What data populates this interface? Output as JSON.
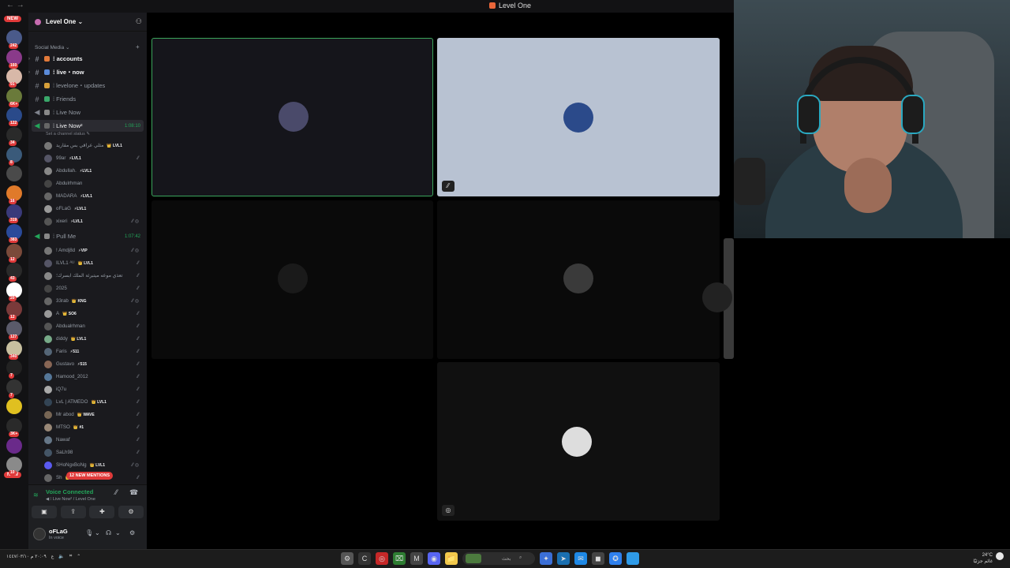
{
  "titlebar": {
    "title": "Level One",
    "back": "←  →"
  },
  "rail": {
    "new_top": "NEW",
    "new_bottom": "NEW",
    "servers": [
      {
        "badge": "242",
        "color": "#4a5a8a"
      },
      {
        "badge": "160",
        "color": "#8a3a8a"
      },
      {
        "badge": "91",
        "color": "#d8b8a8"
      },
      {
        "badge": "6K+",
        "color": "#6a7a3a"
      },
      {
        "badge": "122",
        "color": "#2a4a8a"
      },
      {
        "badge": "34",
        "color": "#2a2a2a"
      },
      {
        "badge": "8",
        "color": "#3a5a7a"
      },
      {
        "badge": "",
        "color": "#4a4a4a"
      },
      {
        "badge": "16",
        "color": "#e07a2a"
      },
      {
        "badge": "319",
        "color": "#3a3a7a"
      },
      {
        "badge": "383",
        "color": "#2a4a9a"
      },
      {
        "badge": "12",
        "color": "#7a4a3a"
      },
      {
        "badge": "43",
        "color": "#2a2a2a"
      },
      {
        "badge": "20",
        "color": "#ffffff"
      },
      {
        "badge": "12",
        "color": "#7a3a3a"
      },
      {
        "badge": "127",
        "color": "#5a5a6a"
      },
      {
        "badge": "340",
        "color": "#c8c0a0"
      },
      {
        "badge": "7",
        "color": "#222222"
      },
      {
        "badge": "7",
        "color": "#333333"
      },
      {
        "badge": "",
        "color": "#e0c020"
      },
      {
        "badge": "3K+",
        "color": "#2a2a2a"
      },
      {
        "badge": "",
        "color": "#6a2a8a"
      },
      {
        "badge": "10",
        "color": "#8a8a8a"
      }
    ]
  },
  "guild": {
    "name": "Level One ⌄",
    "invite_icon": "add-friend-icon"
  },
  "category": {
    "label": "Social Media ⌄",
    "plus": "+"
  },
  "channels": [
    {
      "hash": "#",
      "label": "⁞ accounts",
      "emoji": "#e27a3a",
      "bold": true,
      "arrow": "›"
    },
    {
      "hash": "#",
      "label": "⁞ live・now",
      "emoji": "#5a8ad8",
      "bold": true,
      "arrow": "›"
    },
    {
      "hash": "#",
      "label": "⁞ levelone・updates",
      "emoji": "#d8a03a",
      "bold": false,
      "arrow": ""
    },
    {
      "hash": "#",
      "label": "⁞ Friends",
      "emoji": "#3aa86a",
      "bold": false,
      "arrow": ""
    },
    {
      "hash": "◀",
      "label": "⁞ Live Now",
      "emoji": "#888888",
      "bold": false,
      "arrow": ""
    }
  ],
  "voice_channel_1": {
    "label": "⁞ Live Now²",
    "timer": "1:08:10",
    "status": "Set a channel status ✎"
  },
  "voice_users_1": [
    {
      "name": "مثلي عراقي بس مقاريد",
      "tag": "👑 LVL1",
      "icons": ""
    },
    {
      "name": "99ar",
      "tag": "⚡LVL1",
      "icons": "⁄⁄"
    },
    {
      "name": "Abdullah.",
      "tag": "⚡LVL1",
      "icons": ""
    },
    {
      "name": "Abdulrhman",
      "tag": "",
      "icons": ""
    },
    {
      "name": "MADARA",
      "tag": "⚡LVL1",
      "icons": ""
    },
    {
      "name": "oFLaG",
      "tag": "⚡LVL1",
      "icons": ""
    },
    {
      "name": "xixeri",
      "tag": "⚡LVL1",
      "icons": "⁄⁄ ◎"
    }
  ],
  "voice_channel_2": {
    "label": "⁞ Pull Me",
    "timer": "1:07:42"
  },
  "voice_users_2": [
    {
      "name": "! Amdj8d",
      "tag": "⚡VIP",
      "icons": "⁄⁄ ◎"
    },
    {
      "name": "ILVL1 ᴬᴸᴵ",
      "tag": "👑 LVL1",
      "icons": "⁄⁄"
    },
    {
      "name": "تعذي موعه ميتبرئة الملك ابسرك؛",
      "tag": "",
      "icons": "⁄⁄"
    },
    {
      "name": "2025",
      "tag": "",
      "icons": "⁄⁄"
    },
    {
      "name": "33rab",
      "tag": "👑 KNG",
      "icons": "⁄⁄ ◎"
    },
    {
      "name": "A",
      "tag": "👑 SO6",
      "icons": "⁄⁄"
    },
    {
      "name": "Abdualrhman",
      "tag": "",
      "icons": "⁄⁄"
    },
    {
      "name": "diddy",
      "tag": "👑 LVL1",
      "icons": "⁄⁄"
    },
    {
      "name": "Faris",
      "tag": "⚡511",
      "icons": "⁄⁄"
    },
    {
      "name": "Gustavo",
      "tag": "⚡515",
      "icons": "⁄⁄"
    },
    {
      "name": "Hamood_2012",
      "tag": "",
      "icons": "⁄⁄"
    },
    {
      "name": "iQ7u",
      "tag": "",
      "icons": "⁄⁄"
    },
    {
      "name": "LvL | ATMEDO",
      "tag": "👑 LVL1",
      "icons": "⁄⁄"
    },
    {
      "name": "Mr abod",
      "tag": "👑 WAVE",
      "icons": "⁄⁄"
    },
    {
      "name": "MTSO",
      "tag": "👑 #1",
      "icons": "⁄⁄"
    },
    {
      "name": "Nawaf",
      "tag": "",
      "icons": "⁄⁄"
    },
    {
      "name": "SaLh98",
      "tag": "",
      "icons": "⁄⁄"
    },
    {
      "name": "SHoNgxBoNg",
      "tag": "👑 LVL1",
      "icons": "⁄⁄ ◎"
    },
    {
      "name": "Sh",
      "tag": "👑 LVL1",
      "icons": "⁄⁄"
    }
  ],
  "mentions_pill": "12 NEW MENTIONS",
  "voice_panel": {
    "title": "Voice Connected",
    "subtitle": "◀ ⁞ Live Now² / Level One",
    "buttons": [
      "▣",
      "⇪",
      "✚",
      "⚙"
    ]
  },
  "me": {
    "name": "oFLaG",
    "status": "In voice"
  },
  "tiles": [
    {
      "id": "tile-1",
      "bg": "#15151b",
      "border": "#3ba55c",
      "avatar": "#4a4a6a",
      "mute": ""
    },
    {
      "id": "tile-2",
      "bg": "#b8c2d2",
      "border": "",
      "avatar": "#2b4a8a",
      "mute": "⁄⁄"
    },
    {
      "id": "tile-3",
      "bg": "#0a0a0a",
      "border": "",
      "avatar": "#1a1a1a",
      "mute": ""
    },
    {
      "id": "tile-4",
      "bg": "#0a0a0a",
      "border": "",
      "avatar": "#3a3a3a",
      "mute": ""
    },
    {
      "id": "tile-5",
      "bg": "#3a3a3a",
      "border": "",
      "avatar": "#222222",
      "mute": ""
    },
    {
      "id": "tile-6",
      "bg": "#101010",
      "border": "",
      "avatar": "#dddddd",
      "mute": "◎"
    }
  ],
  "taskbar": {
    "left_text": "٢٠:٠٩ م  ١٤٤٧/٠٣/١٠",
    "search_label": "بحث",
    "weather_temp": "24°C",
    "weather_text": "غائم جزئيًا",
    "apps": [
      "⚙",
      "C",
      "◎",
      "⌧",
      "M",
      "◉",
      "📁",
      "✦",
      "➤",
      "✉",
      "◼",
      "✪"
    ]
  }
}
